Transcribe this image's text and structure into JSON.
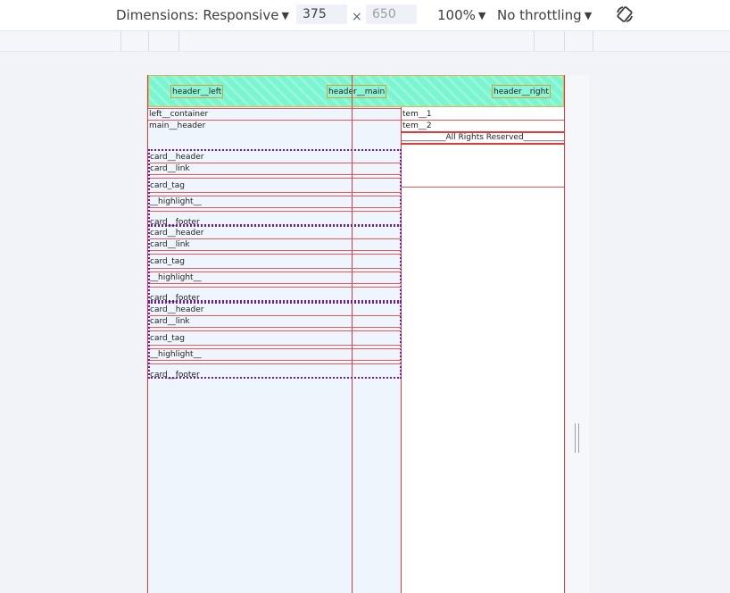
{
  "toolbar": {
    "dimensions_label": "Dimensions: Responsive",
    "width_value": "375",
    "height_placeholder": "650",
    "times_symbol": "×",
    "zoom_label": "100%",
    "throttling_label": "No throttling",
    "rotate_icon": "rotate-icon"
  },
  "header": {
    "left": "header__left",
    "main": "header__main",
    "right": "header__right"
  },
  "left": {
    "container": "left__container",
    "main_header": "main__header"
  },
  "right": {
    "item1": "tem__1",
    "item2": "tem__2",
    "footer": "___________All Rights Reserved___________"
  },
  "cards": [
    {
      "header": "card__header",
      "link": "card__link",
      "tag": "card_tag",
      "highlight": "__highlight__",
      "footer": "card__footer"
    },
    {
      "header": "card__header",
      "link": "card__link",
      "tag": "card_tag",
      "highlight": "__highlight__",
      "footer": "card__footer"
    },
    {
      "header": "card__header",
      "link": "card__link",
      "tag": "card_tag",
      "highlight": "__highlight__",
      "footer": "card__footer"
    }
  ],
  "colors": {
    "outline": "#e03a3a",
    "header_bg": "#79f5cf",
    "card_border": "#6a1bb0",
    "viewport_bg": "#eef5fc"
  }
}
